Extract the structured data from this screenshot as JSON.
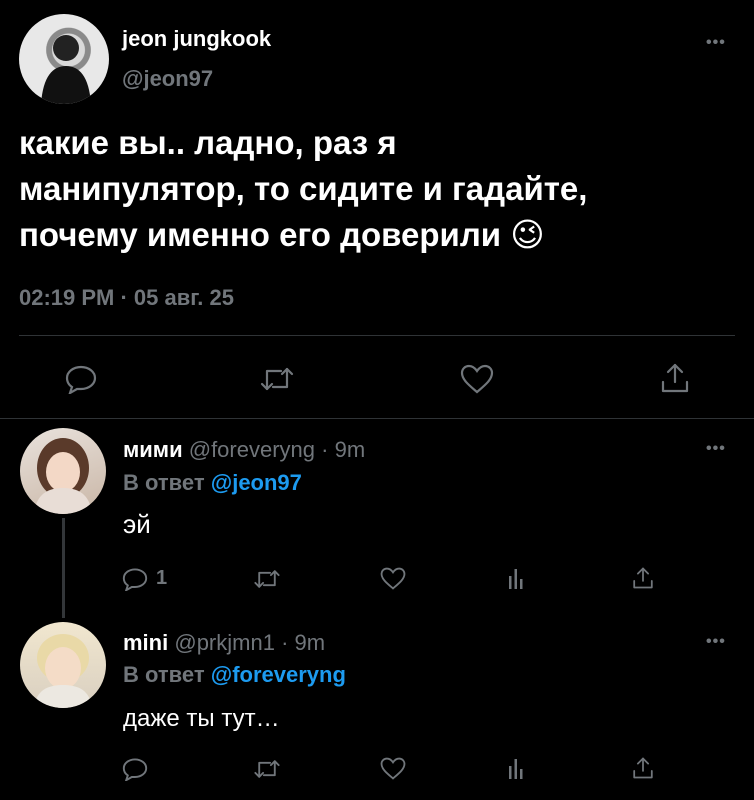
{
  "main_tweet": {
    "author_name": "jeon jungkook",
    "handle": "@jeon97",
    "text_line1": "какие вы.. ладно, раз я",
    "text_line2": "манипулятор, то сидите и гадайте,",
    "text_line3": "почему именно его доверили",
    "emoji": "😉",
    "timestamp": "02:19 PM · 05 авг. 25",
    "more": "•••"
  },
  "replies": [
    {
      "author_name": "мими",
      "handle": "@foreveryng",
      "time": "· 9m",
      "reply_prefix": "В ответ",
      "reply_to": "@jeon97",
      "text": "эй",
      "reply_count": "1",
      "more": "•••"
    },
    {
      "author_name": "mini",
      "handle": "@prkjmn1",
      "time": "· 9m",
      "reply_prefix": "В ответ",
      "reply_to": "@foreveryng",
      "text": "даже ты тут…",
      "more": "•••"
    }
  ],
  "icons": [
    "reply-icon",
    "retweet-icon",
    "like-icon",
    "views-icon",
    "share-icon"
  ],
  "colors": {
    "background": "#000000",
    "text": "#e7e9ea",
    "muted": "#71767b",
    "accent": "#1d9bf0",
    "divider": "#2f3336"
  }
}
